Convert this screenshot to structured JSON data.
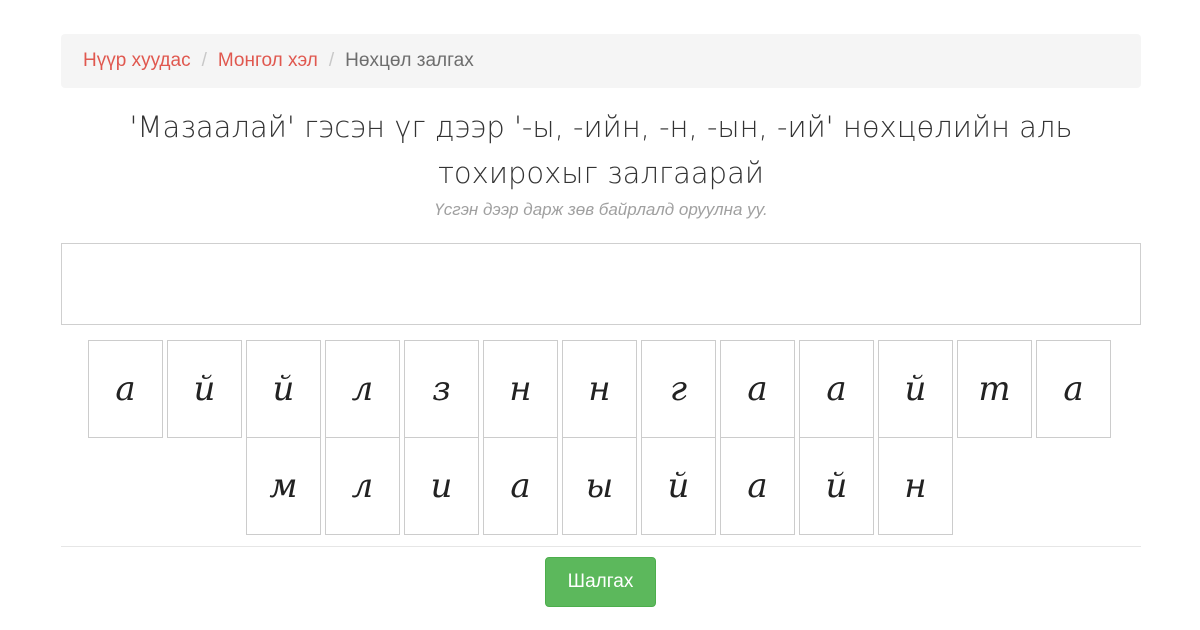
{
  "breadcrumb": {
    "items": [
      "Нүүр хуудас",
      "Монгол хэл"
    ],
    "separator": "/",
    "current": "Нөхцөл залгах"
  },
  "task": {
    "title": "'Мазаалай' гэсэн үг дээр '-ы, -ийн, -н, -ын, -ий' нөхцөлийн аль тохирохыг залгаарай",
    "hint": "Үсгэн дээр дарж зөв байрлалд оруулна уу."
  },
  "answer": {
    "value": ""
  },
  "tiles": {
    "row1": [
      "а",
      "й",
      "й",
      "л",
      "з",
      "н",
      "н",
      "г",
      "а",
      "а",
      "й",
      "т",
      "а"
    ],
    "row2": [
      "м",
      "л",
      "и",
      "а",
      "ы",
      "й",
      "а",
      "й",
      "н"
    ]
  },
  "actions": {
    "submit_label": "Шалгах"
  },
  "colors": {
    "link": "#e0584f",
    "submit": "#5cb85c",
    "breadcrumb_bg": "#f5f5f5"
  }
}
